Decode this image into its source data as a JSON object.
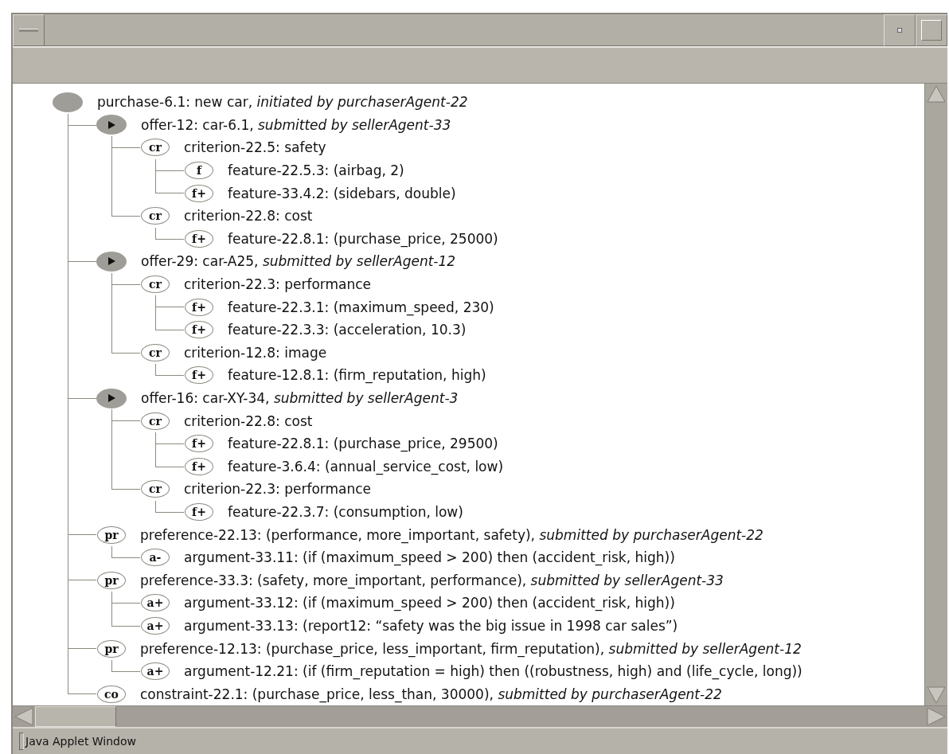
{
  "tree": [
    {
      "kind": "root",
      "text": "purchase-6.1: new car, *initiated by purchaserAgent-22*",
      "children": [
        {
          "kind": "offer",
          "text": "offer-12: car-6.1, *submitted by sellerAgent-33*",
          "children": [
            {
              "kind": "tag",
              "tag": "cr",
              "text": "criterion-22.5: safety",
              "children": [
                {
                  "kind": "tag",
                  "tag": "f",
                  "text": "feature-22.5.3: (airbag, 2)"
                },
                {
                  "kind": "tag",
                  "tag": "f+",
                  "text": "feature-33.4.2: (sidebars, double)"
                }
              ]
            },
            {
              "kind": "tag",
              "tag": "cr",
              "text": "criterion-22.8: cost",
              "children": [
                {
                  "kind": "tag",
                  "tag": "f+",
                  "text": "feature-22.8.1: (purchase_price, 25000)"
                }
              ]
            }
          ]
        },
        {
          "kind": "offer",
          "text": "offer-29: car-A25, *submitted by sellerAgent-12*",
          "children": [
            {
              "kind": "tag",
              "tag": "cr",
              "text": "criterion-22.3: performance",
              "children": [
                {
                  "kind": "tag",
                  "tag": "f+",
                  "text": "feature-22.3.1: (maximum_speed, 230)"
                },
                {
                  "kind": "tag",
                  "tag": "f+",
                  "text": "feature-22.3.3: (acceleration, 10.3)"
                }
              ]
            },
            {
              "kind": "tag",
              "tag": "cr",
              "text": "criterion-12.8: image",
              "children": [
                {
                  "kind": "tag",
                  "tag": "f+",
                  "text": "feature-12.8.1: (firm_reputation, high)"
                }
              ]
            }
          ]
        },
        {
          "kind": "offer",
          "text": "offer-16: car-XY-34, *submitted by sellerAgent-3*",
          "children": [
            {
              "kind": "tag",
              "tag": "cr",
              "text": "criterion-22.8: cost",
              "children": [
                {
                  "kind": "tag",
                  "tag": "f+",
                  "text": "feature-22.8.1: (purchase_price, 29500)"
                },
                {
                  "kind": "tag",
                  "tag": "f+",
                  "text": "feature-3.6.4: (annual_service_cost, low)"
                }
              ]
            },
            {
              "kind": "tag",
              "tag": "cr",
              "text": "criterion-22.3: performance",
              "children": [
                {
                  "kind": "tag",
                  "tag": "f+",
                  "text": "feature-22.3.7: (consumption, low)"
                }
              ]
            }
          ]
        },
        {
          "kind": "tag",
          "tag": "pr",
          "text": "preference-22.13: (performance, more_important, safety), *submitted by purchaserAgent-22*",
          "children": [
            {
              "kind": "tag",
              "tag": "a-",
              "text": "argument-33.11: (if (maximum_speed > 200) then (accident_risk, high))"
            }
          ]
        },
        {
          "kind": "tag",
          "tag": "pr",
          "text": "preference-33.3: (safety, more_important, performance), *submitted by sellerAgent-33*",
          "children": [
            {
              "kind": "tag",
              "tag": "a+",
              "text": "argument-33.12: (if (maximum_speed > 200) then (accident_risk, high))"
            },
            {
              "kind": "tag",
              "tag": "a+",
              "text": "argument-33.13: (report12: “safety was the big issue in 1998 car sales”)"
            }
          ]
        },
        {
          "kind": "tag",
          "tag": "pr",
          "text": "preference-12.13: (purchase_price, less_important, firm_reputation), *submitted by sellerAgent-12*",
          "children": [
            {
              "kind": "tag",
              "tag": "a+",
              "text": "argument-12.21: (if (firm_reputation = high) then ((robustness, high) and (life_cycle, long))"
            }
          ]
        },
        {
          "kind": "tag",
          "tag": "co",
          "text": "constraint-22.1: (purchase_price, less_than, 30000), *submitted by purchaserAgent-22*"
        }
      ]
    }
  ],
  "status_bar": "Java Applet Window"
}
